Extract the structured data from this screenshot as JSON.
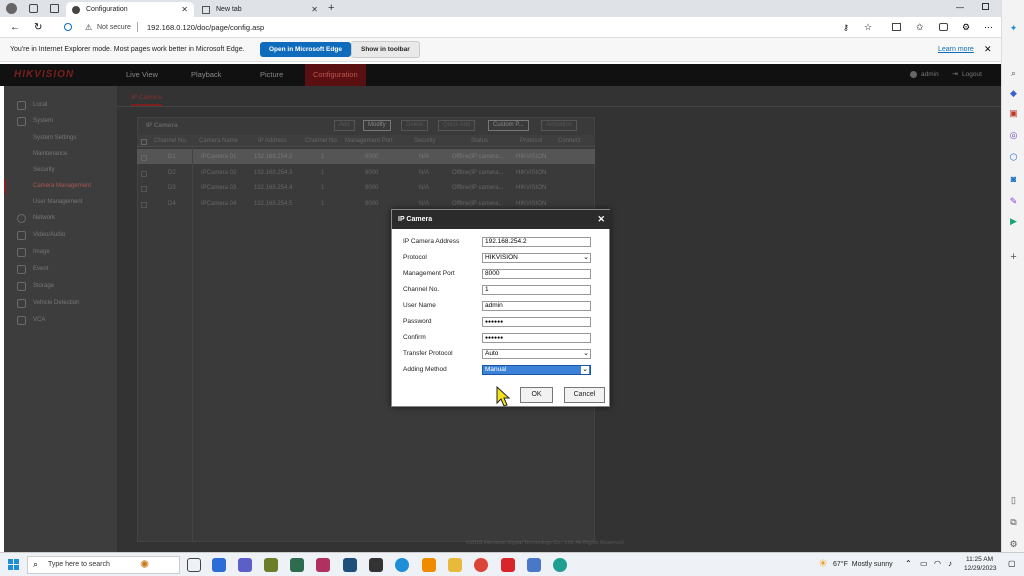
{
  "browser": {
    "tabs": [
      {
        "title": "Configuration",
        "active": true
      },
      {
        "title": "New tab",
        "active": false
      }
    ],
    "address": {
      "security": "Not secure",
      "url": "192.168.0.120/doc/page/config.asp"
    },
    "ie_bar": {
      "message": "You're in Internet Explorer mode. Most pages work better in Microsoft Edge.",
      "open_edge": "Open in Microsoft Edge",
      "show_toolbar": "Show in toolbar",
      "learn_more": "Learn more"
    }
  },
  "app": {
    "logo": "HIKVISION",
    "nav": [
      "Live View",
      "Playback",
      "Picture",
      "Configuration"
    ],
    "user": "admin",
    "logout": "Logout",
    "sidebar": [
      {
        "label": "Local",
        "icon": "monitor-icon"
      },
      {
        "label": "System",
        "icon": "system-icon"
      },
      {
        "label": "System Settings"
      },
      {
        "label": "Maintenance"
      },
      {
        "label": "Security"
      },
      {
        "label": "Camera Management",
        "active": true
      },
      {
        "label": "User Management"
      },
      {
        "label": "Network",
        "icon": "network-icon"
      },
      {
        "label": "Video/Audio",
        "icon": "video-icon"
      },
      {
        "label": "Image",
        "icon": "image-icon"
      },
      {
        "label": "Event",
        "icon": "event-icon"
      },
      {
        "label": "Storage",
        "icon": "storage-icon"
      },
      {
        "label": "Vehicle Detection",
        "icon": "vehicle-icon"
      },
      {
        "label": "VCA",
        "icon": "vca-icon"
      }
    ],
    "main_tab": "IP Camera",
    "section_title": "IP Camera",
    "toolbar": [
      "Add",
      "Modify",
      "Delete",
      "Quick Add",
      "Custom P...",
      "Activation"
    ],
    "columns": [
      "Channel No.",
      "Camera Name",
      "IP Address",
      "Channel No.",
      "Management Port",
      "Security",
      "Status",
      "Protocol",
      "Connect"
    ],
    "rows": [
      [
        "D1",
        "IPCamera 01",
        "192.168.254.2",
        "1",
        "8000",
        "N/A",
        "Offline(IP camera...",
        "HIKVISION"
      ],
      [
        "D2",
        "IPCamera 02",
        "192.168.254.3",
        "1",
        "8000",
        "N/A",
        "Offline(IP camera...",
        "HIKVISION"
      ],
      [
        "D3",
        "IPCamera 03",
        "192.168.254.4",
        "1",
        "8000",
        "N/A",
        "Offline(IP camera...",
        "HIKVISION"
      ],
      [
        "D4",
        "IPCamera 04",
        "192.168.254.5",
        "1",
        "8000",
        "N/A",
        "Offline(IP camera...",
        "HIKVISION"
      ]
    ],
    "footer": "©2018 Hikvision Digital Technology Co., Ltd. All Rights Reserved."
  },
  "dialog": {
    "title": "IP Camera",
    "fields": [
      {
        "label": "IP Camera Address",
        "value": "192.168.254.2",
        "type": "text"
      },
      {
        "label": "Protocol",
        "value": "HIKVISION",
        "type": "select"
      },
      {
        "label": "Management Port",
        "value": "8000",
        "type": "text"
      },
      {
        "label": "Channel No.",
        "value": "1",
        "type": "text"
      },
      {
        "label": "User Name",
        "value": "admin",
        "type": "text"
      },
      {
        "label": "Password",
        "value": "●●●●●●",
        "type": "password"
      },
      {
        "label": "Confirm",
        "value": "●●●●●●",
        "type": "password"
      },
      {
        "label": "Transfer Protocol",
        "value": "Auto",
        "type": "select"
      },
      {
        "label": "Adding Method",
        "value": "Manual",
        "type": "select"
      }
    ],
    "ok": "OK",
    "cancel": "Cancel"
  },
  "taskbar": {
    "search_placeholder": "Type here to search",
    "weather": "67°F  Mostly sunny",
    "time": "11:25 AM",
    "date": "12/29/2023"
  }
}
